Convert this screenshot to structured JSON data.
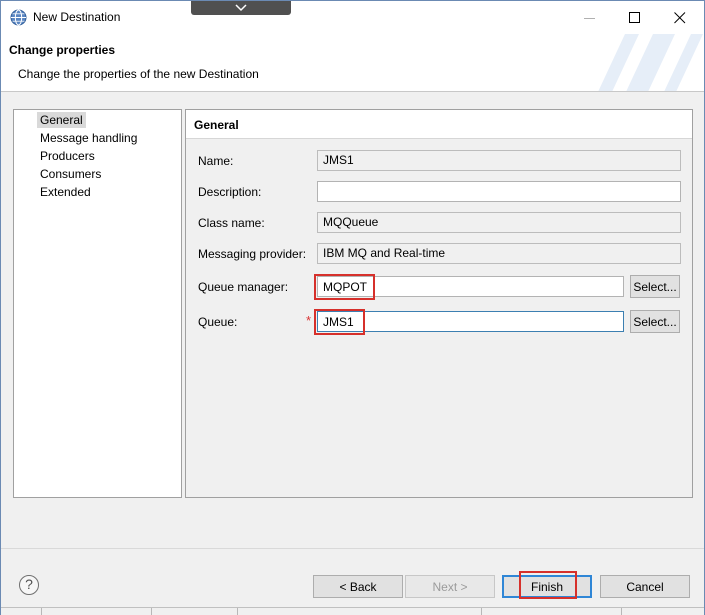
{
  "window": {
    "title": "New Destination",
    "icon": "globe-icon"
  },
  "header": {
    "title": "Change properties",
    "description": "Change the properties of the new Destination"
  },
  "tree": {
    "items": [
      {
        "label": "General",
        "selected": true
      },
      {
        "label": "Message handling",
        "selected": false
      },
      {
        "label": "Producers",
        "selected": false
      },
      {
        "label": "Consumers",
        "selected": false
      },
      {
        "label": "Extended",
        "selected": false
      }
    ]
  },
  "panel": {
    "title": "General",
    "fields": {
      "name": {
        "label": "Name:",
        "value": "JMS1"
      },
      "description": {
        "label": "Description:",
        "value": ""
      },
      "class_name": {
        "label": "Class name:",
        "value": "MQQueue"
      },
      "messaging_provider": {
        "label": "Messaging provider:",
        "value": "IBM MQ and Real-time"
      },
      "queue_manager": {
        "label": "Queue manager:",
        "value": "MQPOT",
        "button": "Select..."
      },
      "queue": {
        "label": "Queue:",
        "value": "JMS1",
        "required_marker": "*",
        "button": "Select..."
      }
    }
  },
  "buttons": {
    "help": "?",
    "back": "< Back",
    "next": "Next >",
    "finish": "Finish",
    "cancel": "Cancel"
  },
  "colors": {
    "highlight": "#d6302b",
    "focus_border": "#2f86d6",
    "required": "#d83434"
  }
}
